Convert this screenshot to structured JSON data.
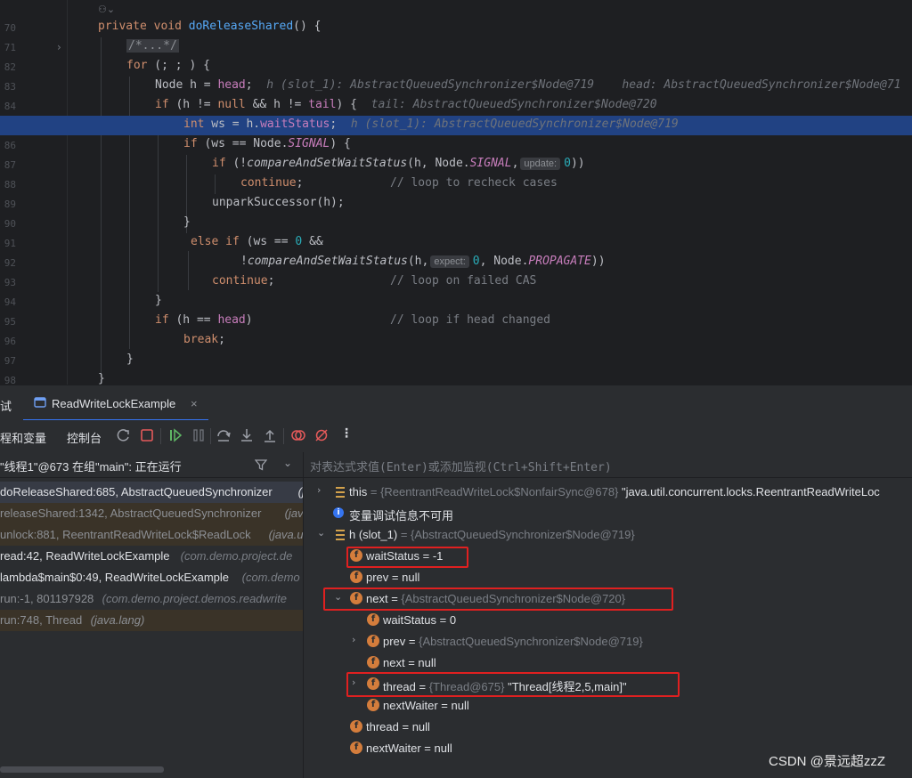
{
  "editor": {
    "gutter_numbers": [
      "70",
      "71",
      "82",
      "83",
      "84",
      "85",
      "86",
      "87",
      "88",
      "89",
      "90",
      "91",
      "92",
      "93",
      "94",
      "95",
      "96",
      "97",
      "98"
    ],
    "line_method": {
      "kw1": "private",
      "kw2": "void",
      "name": "doReleaseShared",
      "rest": "() {"
    },
    "line_fold": "/*...*/",
    "line_for": {
      "kw": "for",
      "rest": " (; ; ) {"
    },
    "line_node": {
      "pre": "Node h = ",
      "fld": "head",
      "post": ";",
      "inline": "h (slot_1): AbstractQueuedSynchronizer$Node@719    head: AbstractQueuedSynchronizer$Node@71"
    },
    "line_if1": {
      "kw": "if",
      "a": " (h != ",
      "kwnull": "null",
      "b": " && h != ",
      "fld": "tail",
      "c": ") {",
      "inline": "tail: AbstractQueuedSynchronizer$Node@720"
    },
    "line_ws": {
      "kw": "int",
      "a": " ws = h.",
      "fld": "waitStatus",
      "b": ";",
      "inline": "h (slot_1): AbstractQueuedSynchronizer$Node@719"
    },
    "line_if2": {
      "kw": "if",
      "a": " (ws == Node.",
      "fld": "SIGNAL",
      "b": ") {"
    },
    "line_if3": {
      "kw": "if",
      "a": " (!",
      "fn": "compareAndSetWaitStatus",
      "b": "(h, Node.",
      "fld": "SIGNAL",
      "c": ",",
      "hint": "update:",
      "num": "0",
      "d": "))"
    },
    "line_continue1": {
      "kw": "continue",
      "a": ";",
      "cmt": "// loop to recheck cases"
    },
    "line_unpark": "unparkSuccessor(h);",
    "line_close1": "}",
    "line_elseif": {
      "kw": "else if",
      "a": " (ws == ",
      "num": "0",
      "b": " &&"
    },
    "line_cas2": {
      "a": "!",
      "fn": "compareAndSetWaitStatus",
      "b": "(h,",
      "hint": "expect:",
      "num": "0",
      "c": ", Node.",
      "fld": "PROPAGATE",
      "d": "))"
    },
    "line_continue2": {
      "kw": "continue",
      "a": ";",
      "cmt": "// loop on failed CAS"
    },
    "line_close2": "}",
    "line_ifhead": {
      "kw": "if",
      "a": " (h == ",
      "fld": "head",
      "b": ")",
      "cmt": "// loop if head changed"
    },
    "line_break": {
      "kw": "break",
      "a": ";"
    },
    "line_close3": "}",
    "line_close4": "}"
  },
  "tool_tabs": {
    "partial_label": "试",
    "active_tab": "ReadWriteLockExample",
    "close": "×"
  },
  "toolbar": {
    "threads_tab": "程和变量",
    "console_tab": "控制台"
  },
  "frames": {
    "thread_selector": "\"线程1\"@673 在组\"main\": 正在运行",
    "rows": [
      {
        "text": "doReleaseShared:685, AbstractQueuedSynchronizer",
        "italic": " (j",
        "style": "current"
      },
      {
        "text": "releaseShared:1342, AbstractQueuedSynchronizer",
        "italic": " (jav",
        "style": "lib"
      },
      {
        "text": "unlock:881, ReentrantReadWriteLock$ReadLock",
        "italic": " (java.u",
        "style": "lib"
      },
      {
        "text": "read:42, ReadWriteLockExample",
        "italic": " (com.demo.project.de",
        "style": "user"
      },
      {
        "text": "lambda$main$0:49, ReadWriteLockExample",
        "italic": " (com.demo",
        "style": "user"
      },
      {
        "text": "run:-1, 801197928",
        "italic": " (com.demo.project.demos.readwrite",
        "style": "user"
      },
      {
        "text": "run:748, Thread",
        "italic": " (java.lang)",
        "style": "lib2"
      }
    ]
  },
  "variables": {
    "eval_placeholder": "对表达式求值(Enter)或添加监视(Ctrl+Shift+Enter)",
    "rows": [
      {
        "name": "this",
        "eq": " = ",
        "ref": "{ReentrantReadWriteLock$NonfairSync@678}",
        "val": " \"java.util.concurrent.locks.ReentrantReadWriteLoc"
      },
      {
        "info": "变量调试信息不可用"
      },
      {
        "name": "h (slot_1)",
        "eq": " = ",
        "ref": "{AbstractQueuedSynchronizer$Node@719}"
      },
      {
        "name": "waitStatus",
        "eq": " = ",
        "val": "-1"
      },
      {
        "name": "prev",
        "eq": " = ",
        "val": "null"
      },
      {
        "name": "next",
        "eq": " = ",
        "ref": "{AbstractQueuedSynchronizer$Node@720}"
      },
      {
        "name": "waitStatus",
        "eq": " = ",
        "val": "0"
      },
      {
        "name": "prev",
        "eq": " = ",
        "ref": "{AbstractQueuedSynchronizer$Node@719}"
      },
      {
        "name": "next",
        "eq": " = ",
        "val": "null"
      },
      {
        "name": "thread",
        "eq": " = ",
        "ref": "{Thread@675}",
        "val": " \"Thread[线程2,5,main]\""
      },
      {
        "name": "nextWaiter",
        "eq": " = ",
        "val": "null"
      },
      {
        "name": "thread",
        "eq": " = ",
        "val": "null"
      },
      {
        "name": "nextWaiter",
        "eq": " = ",
        "val": "null"
      }
    ]
  },
  "watermark": "CSDN @景远超zzZ",
  "colors": {
    "highlight": "#214283",
    "keyword": "#cf8e6d",
    "function": "#56a8f5",
    "field": "#c77dbb",
    "number": "#2aacb8",
    "redbox": "#e02020"
  }
}
